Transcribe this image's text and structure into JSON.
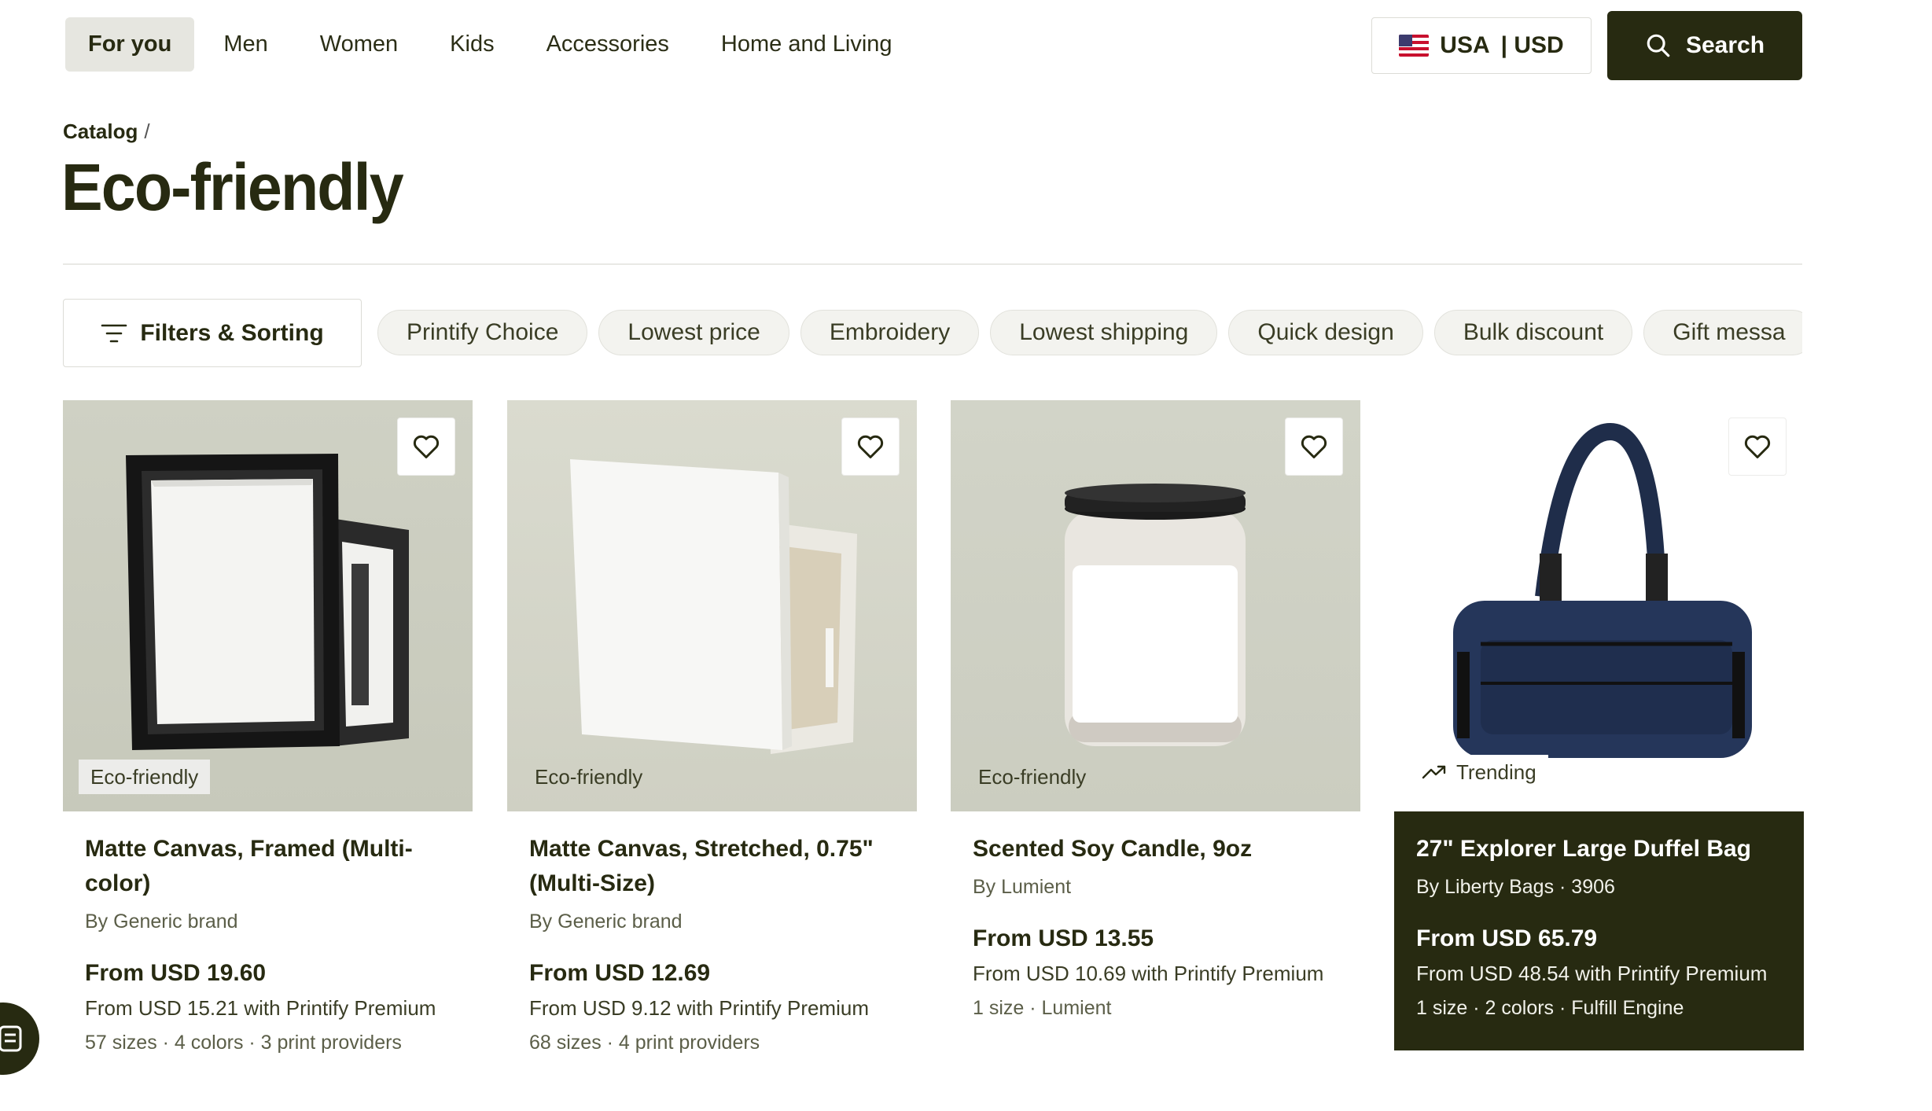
{
  "nav": {
    "items": [
      {
        "label": "For you",
        "active": true
      },
      {
        "label": "Men",
        "active": false
      },
      {
        "label": "Women",
        "active": false
      },
      {
        "label": "Kids",
        "active": false
      },
      {
        "label": "Accessories",
        "active": false
      },
      {
        "label": "Home and Living",
        "active": false
      }
    ],
    "locale": {
      "country": "USA",
      "currency": "| USD",
      "flag_icon": "us-flag-icon"
    },
    "search_label": "Search"
  },
  "breadcrumb": {
    "link": "Catalog",
    "separator": "/"
  },
  "page_title": "Eco-friendly",
  "filters": {
    "button_label": "Filters & Sorting",
    "chips": [
      "Printify Choice",
      "Lowest price",
      "Embroidery",
      "Lowest shipping",
      "Quick design",
      "Bulk discount",
      "Gift messa"
    ]
  },
  "products": [
    {
      "name": "Matte Canvas, Framed (Multi-color)",
      "brand": "By Generic brand",
      "price": "From USD 19.60",
      "premium": "From USD 15.21 with Printify Premium",
      "meta": "57 sizes · 4 colors · 3 print providers",
      "tag": "Eco-friendly"
    },
    {
      "name": "Matte Canvas, Stretched, 0.75\" (Multi-Size)",
      "brand": "By Generic brand",
      "price": "From USD 12.69",
      "premium": "From USD 9.12 with Printify Premium",
      "meta": "68 sizes · 4 print providers",
      "tag": "Eco-friendly"
    },
    {
      "name": "Scented Soy Candle, 9oz",
      "brand": "By Lumient",
      "price": "From USD 13.55",
      "premium": "From USD 10.69 with Printify Premium",
      "meta": "1 size · Lumient",
      "tag": "Eco-friendly"
    },
    {
      "name": "27\" Explorer Large Duffel Bag",
      "brand": "By Liberty Bags · 3906",
      "price": "From USD 65.79",
      "premium": "From USD 48.54 with Printify Premium",
      "meta": "1 size · 2 colors · Fulfill Engine",
      "tag": "Trending"
    }
  ],
  "colors": {
    "primary_dark": "#272a11",
    "chip_bg": "#f3f3ef",
    "active_nav_bg": "#e6e6e0"
  }
}
